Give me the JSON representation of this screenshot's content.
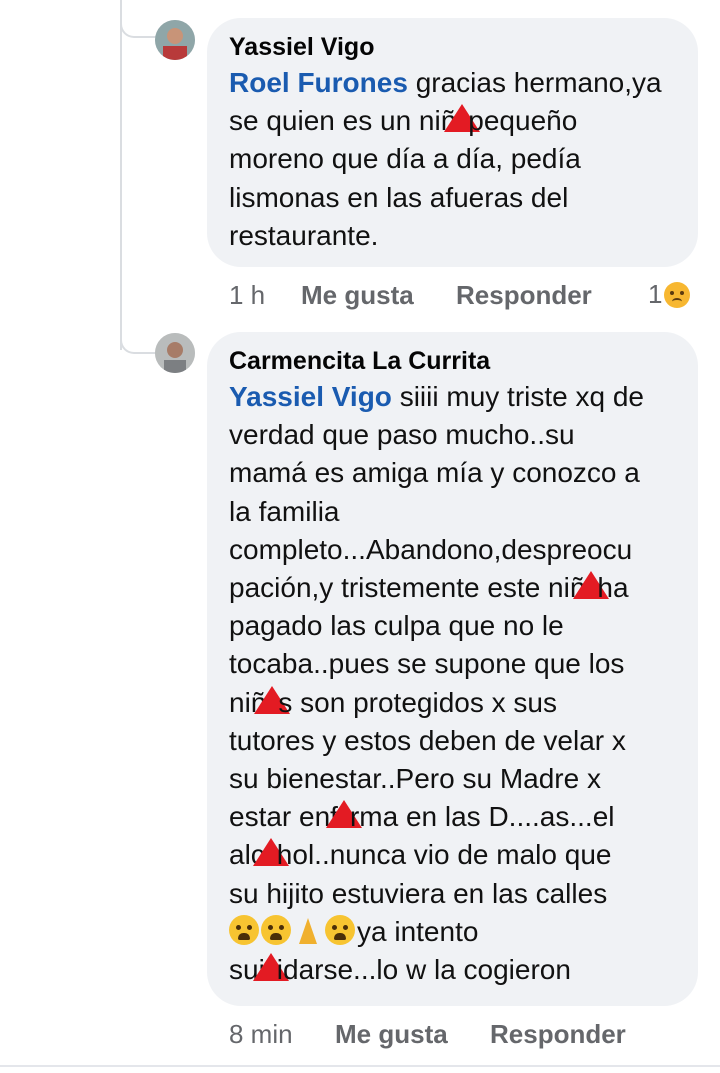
{
  "comments": [
    {
      "author": "Yassiel Vigo",
      "mention": "Roel Furones",
      "text": " gracias hermano,ya\nse quien es un niñ",
      "text2": "pequeño\nmoreno que día a día, pedía\nlismonas en las afueras del\nrestaurante.",
      "time": "1 h",
      "like": "Me gusta",
      "reply": "Responder",
      "reaction_count": "1",
      "reaction_icon": "sad-face-icon"
    },
    {
      "author": "Carmencita La Currita",
      "mention": "Yassiel Vigo",
      "segments": [
        " siiii muy triste xq de\nverdad que paso mucho..su\nmamá es amiga mía y conozco a\nla familia\ncompleto...Abandono,despreocu\npación,y tristemente este niñ",
        "ha\npagado las culpa que no le\ntocaba..pues se supone que los\nniñ",
        "s son protegidos x sus\ntutores y estos deben de velar x\nsu bienestar..Pero su Madre x\nestar enf",
        "rma en las D....as...el\nalc",
        "hol..nunca vio de malo que\nsu hijito estuviera en las calles\n",
        "ya intento\nsui",
        "idarse...lo w la cogieron"
      ],
      "time": "8 min",
      "like": "Me gusta",
      "reply": "Responder"
    }
  ]
}
